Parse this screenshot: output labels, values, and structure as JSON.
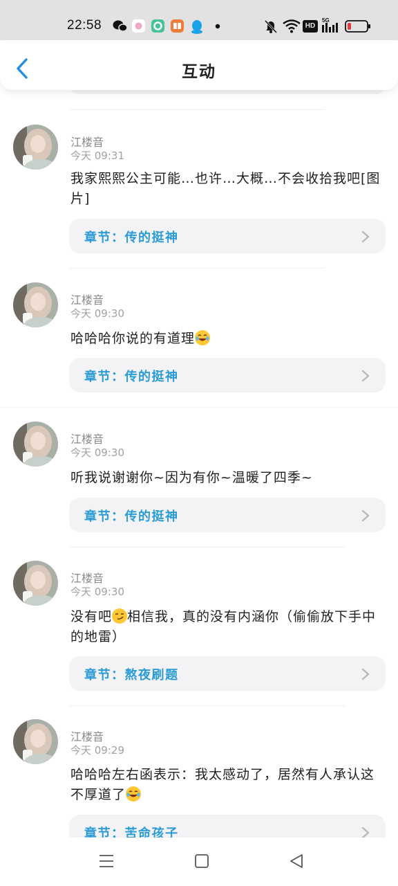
{
  "status_bar": {
    "time": "22:58",
    "indicators": [
      "bell-off-icon",
      "wifi-icon",
      "hd-badge",
      "signal-5g-icon",
      "battery-low-icon"
    ],
    "hd_label": "HD",
    "net_label": "5G"
  },
  "header": {
    "title": "互动"
  },
  "comments": [
    {
      "user": "江楼音",
      "time": "今天 09:31",
      "text": "我家熙熙公主可能…也许…大概…不会收拾我吧[图片]",
      "chapter": "章节：传的挺神"
    },
    {
      "user": "江楼音",
      "time": "今天 09:30",
      "text": "哈哈哈你说的有道理",
      "chapter": "章节：传的挺神"
    },
    {
      "user": "江楼音",
      "time": "今天 09:30",
      "text": "听我说谢谢你~因为有你~温暖了四季~",
      "chapter": "章节：传的挺神"
    },
    {
      "user": "江楼音",
      "time": "今天 09:30",
      "text_before": "没有吧",
      "text_after": "相信我，真的没有内涵你（偷偷放下手中的地雷）",
      "chapter": "章节：熬夜刷题"
    },
    {
      "user": "江楼音",
      "time": "今天 09:29",
      "text": "哈哈哈左右函表示：我太感动了，居然有人承认这不厚道了",
      "chapter": "章节：苦命孩子"
    }
  ],
  "colors": {
    "accent": "#2b9bd7",
    "card_bg": "#f3f3f5",
    "status_bg": "#e2e2e2"
  }
}
